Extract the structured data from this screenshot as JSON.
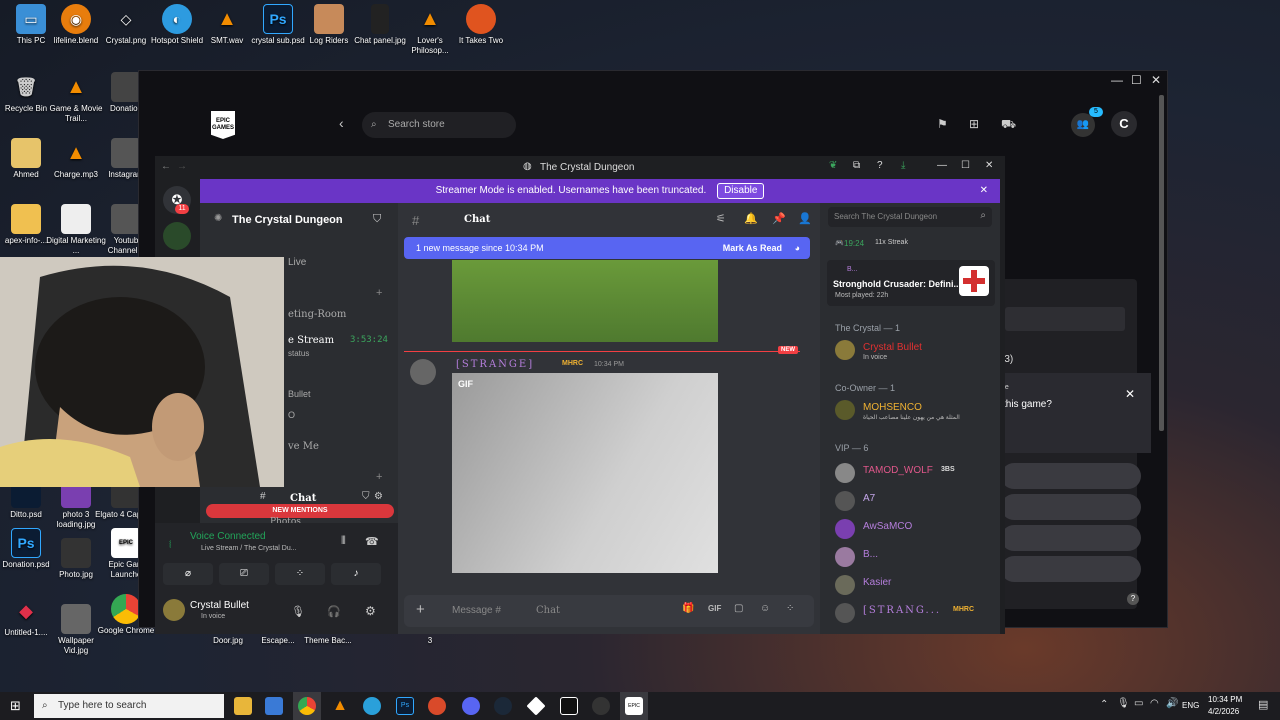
{
  "desktop": {
    "icons": [
      {
        "label": "This PC"
      },
      {
        "label": "lifeline.blend"
      },
      {
        "label": "Crystal.png"
      },
      {
        "label": "Hotspot Shield"
      },
      {
        "label": "SMT.wav"
      },
      {
        "label": "crystal sub.psd"
      },
      {
        "label": "Log Riders"
      },
      {
        "label": "Chat panel.jpg"
      },
      {
        "label": "Lover's Philosop..."
      },
      {
        "label": "It Takes Two"
      },
      {
        "label": "Recycle Bin"
      },
      {
        "label": "Game & Movie Trail..."
      },
      {
        "label": "Donation"
      },
      {
        "label": "Ahmed"
      },
      {
        "label": "Charge.mp3"
      },
      {
        "label": "Instagram"
      },
      {
        "label": "apex-info-..."
      },
      {
        "label": "Digital Marketing ..."
      },
      {
        "label": "Youtub Channel.p"
      },
      {
        "label": "Ditto.psd"
      },
      {
        "label": "photo 3 loading.jpg"
      },
      {
        "label": "Elgato 4 Captur..."
      },
      {
        "label": "Donation.psd"
      },
      {
        "label": "Photo.jpg"
      },
      {
        "label": "Epic Gam Launche"
      },
      {
        "label": "Untitled-1...."
      },
      {
        "label": "Wallpaper Vid.jpg"
      },
      {
        "label": "Google Chrome"
      },
      {
        "label": "Door.jpg"
      },
      {
        "label": "Escape..."
      },
      {
        "label": "Theme Bac..."
      },
      {
        "label": "3"
      }
    ]
  },
  "epic": {
    "logo_text": "EPIC GAMES",
    "search_placeholder": "Search store",
    "friends_badge": "5",
    "avatar_letter": "C",
    "panel_text": {
      "count": "(3)",
      "question": "this game?",
      "label_e": "ue"
    }
  },
  "discord": {
    "window_title": "The Crystal Dungeon",
    "streamer_mode_text": "Streamer Mode is enabled. Usernames have been truncated.",
    "disable_label": "Disable",
    "server_name": "The Crystal Dungeon",
    "home_badge": "11",
    "channels": [
      {
        "name": "Live"
      },
      {
        "name": "eting-Room"
      },
      {
        "name": "e Stream",
        "time": "3:53:24"
      },
      {
        "name": "status"
      },
      {
        "name": "Bullet"
      },
      {
        "name": "O"
      },
      {
        "name": "ve Me"
      },
      {
        "name": "Photos"
      }
    ],
    "current_channel_label": "Chat",
    "new_mentions_label": "NEW MENTIONS",
    "voice": {
      "status": "Voice Connected",
      "channel": "Live Stream / The Crystal Du..."
    },
    "user": {
      "name": "Crystal Bullet",
      "status": "In voice"
    },
    "chat_header": "Chat",
    "search_placeholder": "Search The Crystal Dungeon",
    "new_message_bar": "1 new message since 10:34 PM",
    "mark_as_read": "Mark As Read",
    "new_tag": "NEW",
    "message": {
      "author": "[STRANGE]",
      "tag": "MHRC",
      "time": "10:34 PM",
      "gif_label": "GIF"
    },
    "composer_placeholder": "Message #",
    "composer_channel": "Chat",
    "members_panel": {
      "activity_time": "19:24",
      "activity_streak": "11x Streak",
      "game_title": "Stronghold Crusader: Defini...",
      "game_sub": "Most played: 22h",
      "game_user": "B...",
      "groups": [
        {
          "title": "The Crystal — 1",
          "members": [
            {
              "name": "Crystal Bullet",
              "status": "In voice",
              "color": "#e03131"
            }
          ]
        },
        {
          "title": "Co-Owner — 1",
          "members": [
            {
              "name": "MOHSENCO",
              "status": "المثلة هي من يهون علينا مصاعب الحياة",
              "color": "#f0b232"
            }
          ]
        },
        {
          "title": "VIP — 6",
          "members": [
            {
              "name": "TAMOD_WOLF",
              "tag": "3BS",
              "color": "#e0578a"
            },
            {
              "name": "A7",
              "color": "#c3a5e8"
            },
            {
              "name": "AwSaMCO",
              "color": "#b57edc"
            },
            {
              "name": "B...",
              "color": "#b57edc"
            },
            {
              "name": "Kasier",
              "color": "#b57edc"
            },
            {
              "name": "[STRANG...",
              "tag": "MHRC",
              "color": "#b57edc"
            }
          ]
        }
      ]
    }
  },
  "taskbar": {
    "search_placeholder": "Type here to search",
    "language": "ENG",
    "time": "10:34 PM",
    "date": "4/2/2026"
  },
  "colors": {
    "discord_blurple": "#5865f2",
    "streamer_purple": "#6a35c6",
    "mention_red": "#da373c",
    "voice_green": "#23a55a"
  }
}
